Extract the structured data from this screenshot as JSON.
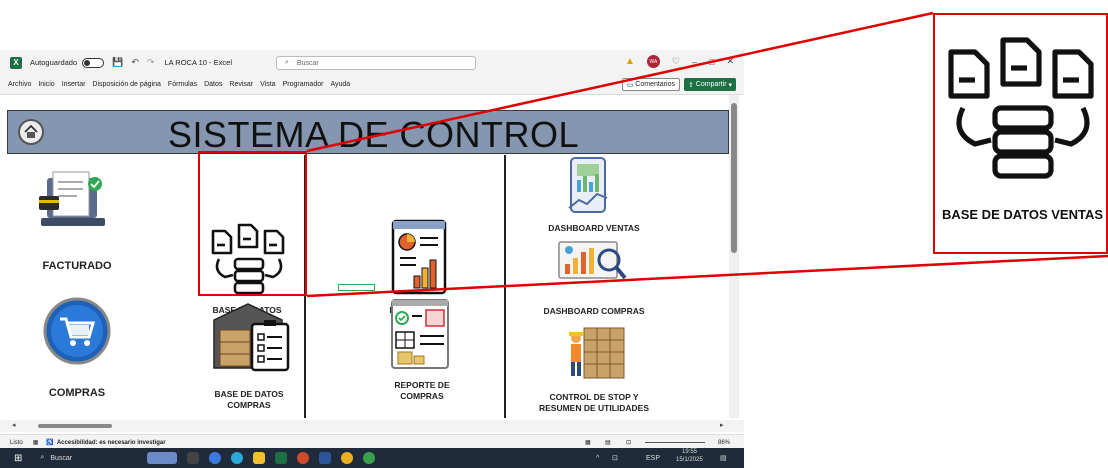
{
  "titlebar": {
    "autosave_label": "Autoguardado",
    "filename": "LA ROCA 10",
    "app_name": "Excel",
    "filename_sep": " - ",
    "search_placeholder": "Buscar",
    "user_initials": "WA"
  },
  "menubar": {
    "items": [
      "Archivo",
      "Inicio",
      "Insertar",
      "Disposición de página",
      "Fórmulas",
      "Datos",
      "Revisar",
      "Vista",
      "Programador",
      "Ayuda"
    ],
    "comments_label": "Comentarios",
    "share_label": "Compartir"
  },
  "sheet": {
    "title": "SISTEMA DE CONTROL",
    "tiles": {
      "facturado": "FACTURADO",
      "base_datos_ventas": "BASE DE DATOS VENTAS",
      "reporte_ventas": "REPORTE DE VENTAS",
      "dashboard_ventas": "DASHBOARD VENTAS",
      "dashboard_compras": "DASHBOARD COMPRAS",
      "compras": "COMPRAS",
      "base_datos_compras": "BASE DE DATOS COMPRAS",
      "reporte_compras": "REPORTE DE COMPRAS",
      "control_stop": "CONTROL DE STOP Y RESUMEN DE UTILIDADES"
    }
  },
  "statusbar": {
    "ready": "Listo",
    "accessibility": "Accesibilidad: es necesario investigar",
    "zoom": "86%"
  },
  "taskbar": {
    "search_placeholder": "Buscar",
    "language": "ESP",
    "time": "19:55",
    "date": "15/1/2025"
  },
  "zoom_callout": {
    "label": "BASE DE DATOS VENTAS"
  },
  "colors": {
    "banner": "#8496b0",
    "callout_red": "#e00000",
    "excel_green": "#1d7044"
  }
}
